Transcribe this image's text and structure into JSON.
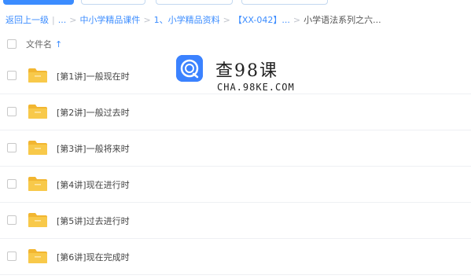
{
  "breadcrumb": {
    "back": "返回上一级",
    "ellipsis1": "...",
    "items": [
      "中小学精品课件",
      "1、小学精品资料",
      "【XX-042】...",
      "小学语法系列之六..."
    ]
  },
  "header": {
    "column": "文件名",
    "sort_icon": "arrow-up-icon"
  },
  "files": [
    {
      "name": "[第1讲]一般现在时",
      "icon": "folder-icon"
    },
    {
      "name": "[第2讲]一般过去时",
      "icon": "folder-icon"
    },
    {
      "name": "[第3讲]一般将来时",
      "icon": "folder-icon"
    },
    {
      "name": "[第4讲]现在进行时",
      "icon": "folder-icon"
    },
    {
      "name": "[第5讲]过去进行时",
      "icon": "folder-icon"
    },
    {
      "name": "[第6讲]现在完成时",
      "icon": "folder-icon"
    }
  ],
  "watermark": {
    "title": "查98课",
    "subtitle": "CHA.98KE.COM"
  },
  "colors": {
    "accent": "#3b8cff",
    "folder": "#f8c94a",
    "folder_dark": "#f2b631"
  }
}
